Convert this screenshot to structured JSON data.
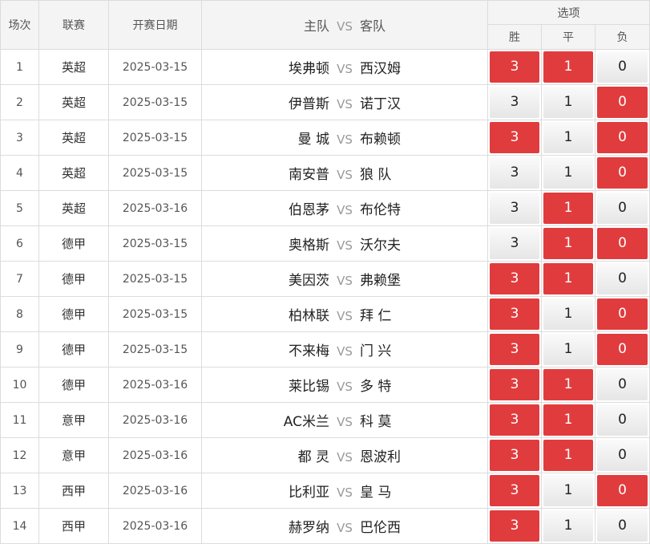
{
  "header": {
    "num": "场次",
    "league": "联赛",
    "date": "开赛日期",
    "home": "主队",
    "vs": "VS",
    "away": "客队",
    "options": "选项",
    "win": "胜",
    "draw": "平",
    "lose": "负"
  },
  "option_values": {
    "win": "3",
    "draw": "1",
    "lose": "0"
  },
  "colors": {
    "selected": "#e03c3e",
    "header_bg": "#f4f4f4"
  },
  "rows": [
    {
      "num": "1",
      "league": "英超",
      "date": "2025-03-15",
      "home": "埃弗顿",
      "vs": "VS",
      "away": "西汉姆",
      "selected": [
        "win",
        "draw"
      ]
    },
    {
      "num": "2",
      "league": "英超",
      "date": "2025-03-15",
      "home": "伊普斯",
      "vs": "VS",
      "away": "诺丁汉",
      "selected": [
        "lose"
      ]
    },
    {
      "num": "3",
      "league": "英超",
      "date": "2025-03-15",
      "home": "曼 城",
      "vs": "VS",
      "away": "布赖顿",
      "selected": [
        "win",
        "lose"
      ]
    },
    {
      "num": "4",
      "league": "英超",
      "date": "2025-03-15",
      "home": "南安普",
      "vs": "VS",
      "away": "狼 队",
      "selected": [
        "lose"
      ]
    },
    {
      "num": "5",
      "league": "英超",
      "date": "2025-03-16",
      "home": "伯恩茅",
      "vs": "VS",
      "away": "布伦特",
      "selected": [
        "draw"
      ]
    },
    {
      "num": "6",
      "league": "德甲",
      "date": "2025-03-15",
      "home": "奥格斯",
      "vs": "VS",
      "away": "沃尔夫",
      "selected": [
        "draw",
        "lose"
      ]
    },
    {
      "num": "7",
      "league": "德甲",
      "date": "2025-03-15",
      "home": "美因茨",
      "vs": "VS",
      "away": "弗赖堡",
      "selected": [
        "win",
        "draw"
      ]
    },
    {
      "num": "8",
      "league": "德甲",
      "date": "2025-03-15",
      "home": "柏林联",
      "vs": "VS",
      "away": "拜 仁",
      "selected": [
        "win",
        "lose"
      ]
    },
    {
      "num": "9",
      "league": "德甲",
      "date": "2025-03-15",
      "home": "不来梅",
      "vs": "VS",
      "away": "门 兴",
      "selected": [
        "win",
        "lose"
      ]
    },
    {
      "num": "10",
      "league": "德甲",
      "date": "2025-03-16",
      "home": "莱比锡",
      "vs": "VS",
      "away": "多 特",
      "selected": [
        "win",
        "draw"
      ]
    },
    {
      "num": "11",
      "league": "意甲",
      "date": "2025-03-16",
      "home": "AC米兰",
      "vs": "VS",
      "away": "科 莫",
      "selected": [
        "win",
        "draw"
      ]
    },
    {
      "num": "12",
      "league": "意甲",
      "date": "2025-03-16",
      "home": "都 灵",
      "vs": "VS",
      "away": "恩波利",
      "selected": [
        "win",
        "draw"
      ]
    },
    {
      "num": "13",
      "league": "西甲",
      "date": "2025-03-16",
      "home": "比利亚",
      "vs": "VS",
      "away": "皇 马",
      "selected": [
        "win",
        "lose"
      ]
    },
    {
      "num": "14",
      "league": "西甲",
      "date": "2025-03-16",
      "home": "赫罗纳",
      "vs": "VS",
      "away": "巴伦西",
      "selected": [
        "win"
      ]
    }
  ]
}
